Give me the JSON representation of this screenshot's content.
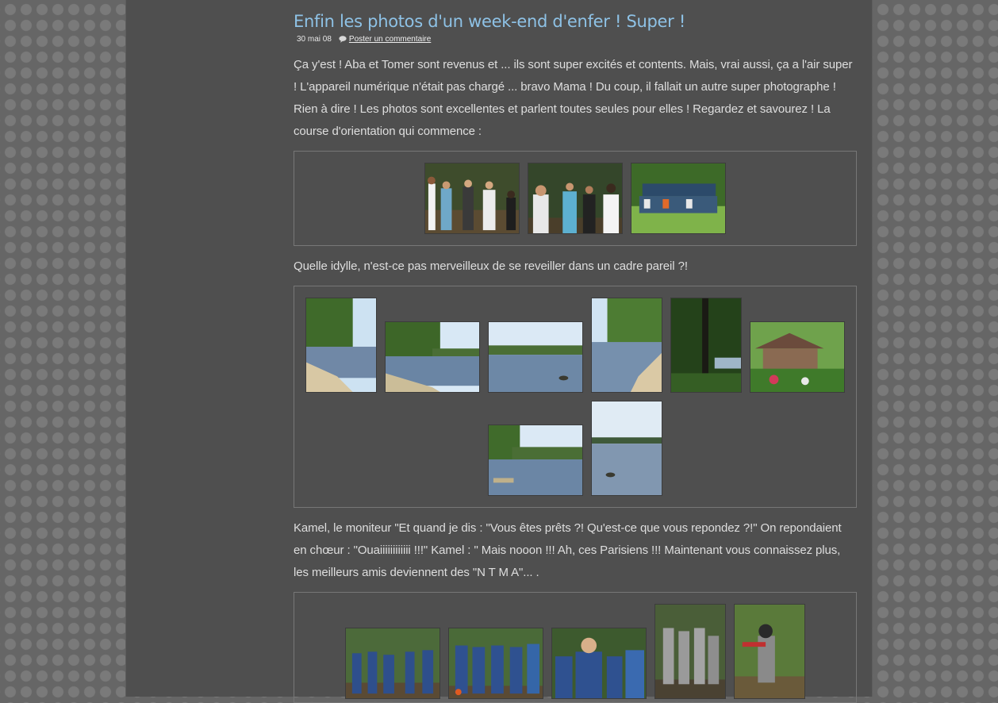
{
  "post": {
    "title": "Enfin les photos d'un week-end d'enfer ! Super !",
    "date": "30 mai 08",
    "comment_link": "Poster un commentaire",
    "paragraphs": [
      "Ça y'est ! Aba et Tomer sont revenus et ... ils sont super excités et contents. Mais, vrai aussi, ça a l'air super ! L'appareil numérique n'était pas chargé ... bravo Mama ! Du coup, il fallait un autre super photographe ! Rien à dire ! Les photos sont excellentes et parlent toutes seules pour elles ! Regardez et savourez ! La course d'orientation qui commence :",
      "Quelle idylle, n'est-ce pas merveilleux de se reveiller dans un cadre pareil ?!",
      "Kamel, le moniteur \"Et quand je dis : \"Vous êtes prêts ?! Qu'est-ce que vous repondez ?!\" On repondaient en chœur : \"Ouaiiiiiiiiiiii !!!\" Kamel : \" Mais nooon !!! Ah, ces Parisiens !!! Maintenant vous connaissez plus, les meilleurs amis deviennent des \"N T M A\"... ."
    ]
  },
  "colors": {
    "title": "#8ec2e6",
    "page_background": "#4f4f4f",
    "body_text": "#dedede",
    "gallery_border": "#777777"
  },
  "icons": {
    "comment": "speech-bubble-icon"
  }
}
